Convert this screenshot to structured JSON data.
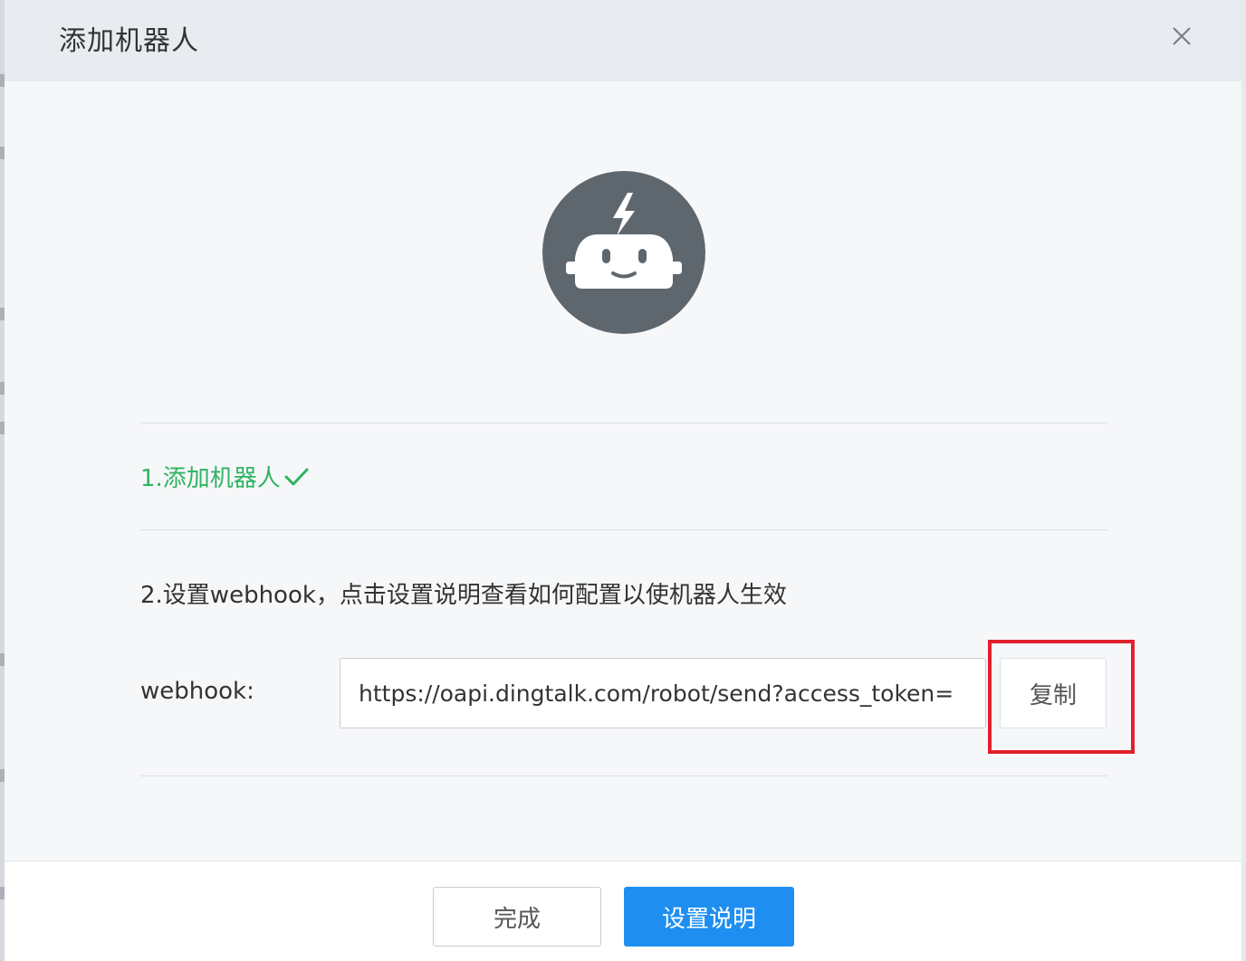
{
  "dialog": {
    "title": "添加机器人"
  },
  "icons": {
    "close": "close-icon",
    "robot": "robot-avatar-icon",
    "check": "check-icon"
  },
  "steps": {
    "step1_label": "1.添加机器人",
    "step2_label": "2.设置webhook，点击设置说明查看如何配置以使机器人生效"
  },
  "webhook": {
    "label": "webhook:",
    "value": "https://oapi.dingtalk.com/robot/send?access_token=",
    "copy_label": "复制"
  },
  "footer": {
    "done_label": "完成",
    "guide_label": "设置说明"
  },
  "colors": {
    "success": "#2fb362",
    "primary": "#1e8ff0",
    "highlight": "#e0202e",
    "avatar_bg": "#5f676e"
  }
}
